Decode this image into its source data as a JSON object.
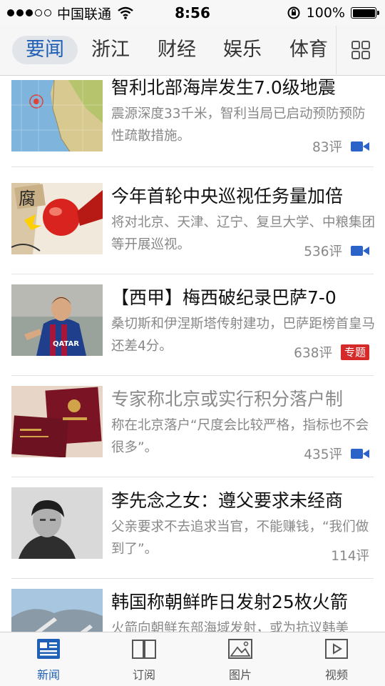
{
  "status_bar": {
    "carrier": "中国联通",
    "time": "8:56",
    "battery": "100%"
  },
  "tabs": [
    {
      "label": "要闻",
      "active": true
    },
    {
      "label": "浙江",
      "active": false
    },
    {
      "label": "财经",
      "active": false
    },
    {
      "label": "娱乐",
      "active": false
    },
    {
      "label": "体育",
      "active": false
    }
  ],
  "news": [
    {
      "title": "智利北部海岸发生7.0级地震",
      "summary": "震源深度33千米，智利当局已启动预防预防性疏散措施。",
      "comments": "83评",
      "badge": "video-icon",
      "thumb": "map-thumbnail"
    },
    {
      "title": "今年首轮中央巡视任务量加倍",
      "summary": "将对北京、天津、辽宁、复旦大学、中粮集团等开展巡视。",
      "comments": "536评",
      "badge": "video-icon",
      "thumb": "cartoon-thumbnail",
      "thumb_text": "腐"
    },
    {
      "title": "【西甲】梅西破纪录巴萨7-0",
      "summary": "桑切斯和伊涅斯塔传射建功，巴萨距榜首皇马还差4分。",
      "comments": "638评",
      "badge": "tag",
      "tag": "专题",
      "thumb": "football-thumbnail",
      "thumb_text": "QATAR"
    },
    {
      "title": "专家称北京或实行积分落户制",
      "summary": "称在北京落户“尺度会比较严格，指标也不会很多”。",
      "comments": "435评",
      "badge": "video-icon",
      "thumb": "hukou-thumbnail",
      "read": true
    },
    {
      "title": "李先念之女：遵父要求未经商",
      "summary": "父亲要求不去追求当官，不能赚钱，“我们做到了”。",
      "comments": "114评",
      "badge": "none",
      "thumb": "portrait-thumbnail"
    },
    {
      "title": "韩国称朝鲜昨日发射25枚火箭",
      "summary": "火箭向朝鲜东部海域发射，或为抗议韩美",
      "comments": "",
      "badge": "none",
      "thumb": "rocket-thumbnail"
    }
  ],
  "tabbar": [
    {
      "label": "新闻",
      "icon": "news-icon",
      "active": true
    },
    {
      "label": "订阅",
      "icon": "book-icon",
      "active": false
    },
    {
      "label": "图片",
      "icon": "picture-icon",
      "active": false
    },
    {
      "label": "视频",
      "icon": "play-icon",
      "active": false
    }
  ],
  "colors": {
    "accent": "#1f5fb5",
    "tag": "#d62a2a",
    "video_icon": "#2b63c9"
  }
}
